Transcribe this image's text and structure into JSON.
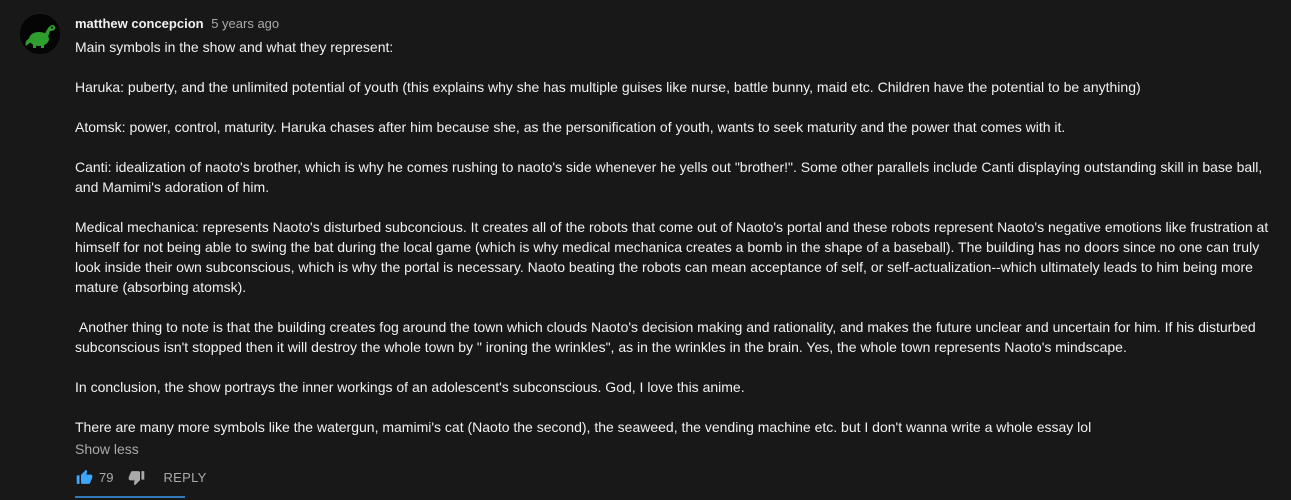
{
  "comment": {
    "author": "matthew concepcion",
    "timestamp": "5 years ago",
    "avatar_icon": "green-dinosaur-avatar",
    "paragraphs": [
      "Main symbols in the show and what they represent:",
      "Haruka: puberty, and the unlimited potential of youth (this explains why she has multiple guises like nurse, battle bunny, maid etc. Children have the potential to be anything)",
      "Atomsk: power, control, maturity. Haruka chases after him because she, as the personification of youth, wants to seek maturity and the power that comes with it.",
      "Canti: idealization of naoto's brother, which is why he comes rushing to naoto's side whenever he yells out \"brother!\". Some other parallels include Canti displaying outstanding skill in base ball, and Mamimi's adoration of him.",
      "Medical mechanica: represents Naoto's disturbed subconcious. It creates all of the robots that come out of Naoto's portal and these robots represent Naoto's negative emotions like frustration at himself for not being able to swing the bat during the local game (which is why medical mechanica creates a bomb in the shape of a baseball). The building has no doors since no one can truly look inside their own subconscious, which is why the portal is necessary. Naoto beating the robots can mean acceptance of self, or self-actualization--which ultimately leads to him being more mature (absorbing atomsk).",
      " Another thing to note is that the building creates fog around the town which clouds Naoto's decision making and rationality, and makes the future unclear and uncertain for him. If his disturbed subconscious isn't stopped then it will destroy the whole town by \" ironing the wrinkles\", as in the wrinkles in the brain. Yes, the whole town represents Naoto's mindscape.",
      "In conclusion, the show portrays the inner workings of an adolescent's subconscious. God, I love this anime.",
      "There are many more symbols like the watergun, mamimi's cat (Naoto the second), the seaweed, the vending machine etc. but I don't wanna write a whole essay lol"
    ],
    "show_less_label": "Show less",
    "like_count": "79",
    "reply_label": "REPLY",
    "colors": {
      "like_active": "#3ea6ff",
      "dislike": "#aaaaaa",
      "avatar_green": "#2e9e2e"
    }
  }
}
